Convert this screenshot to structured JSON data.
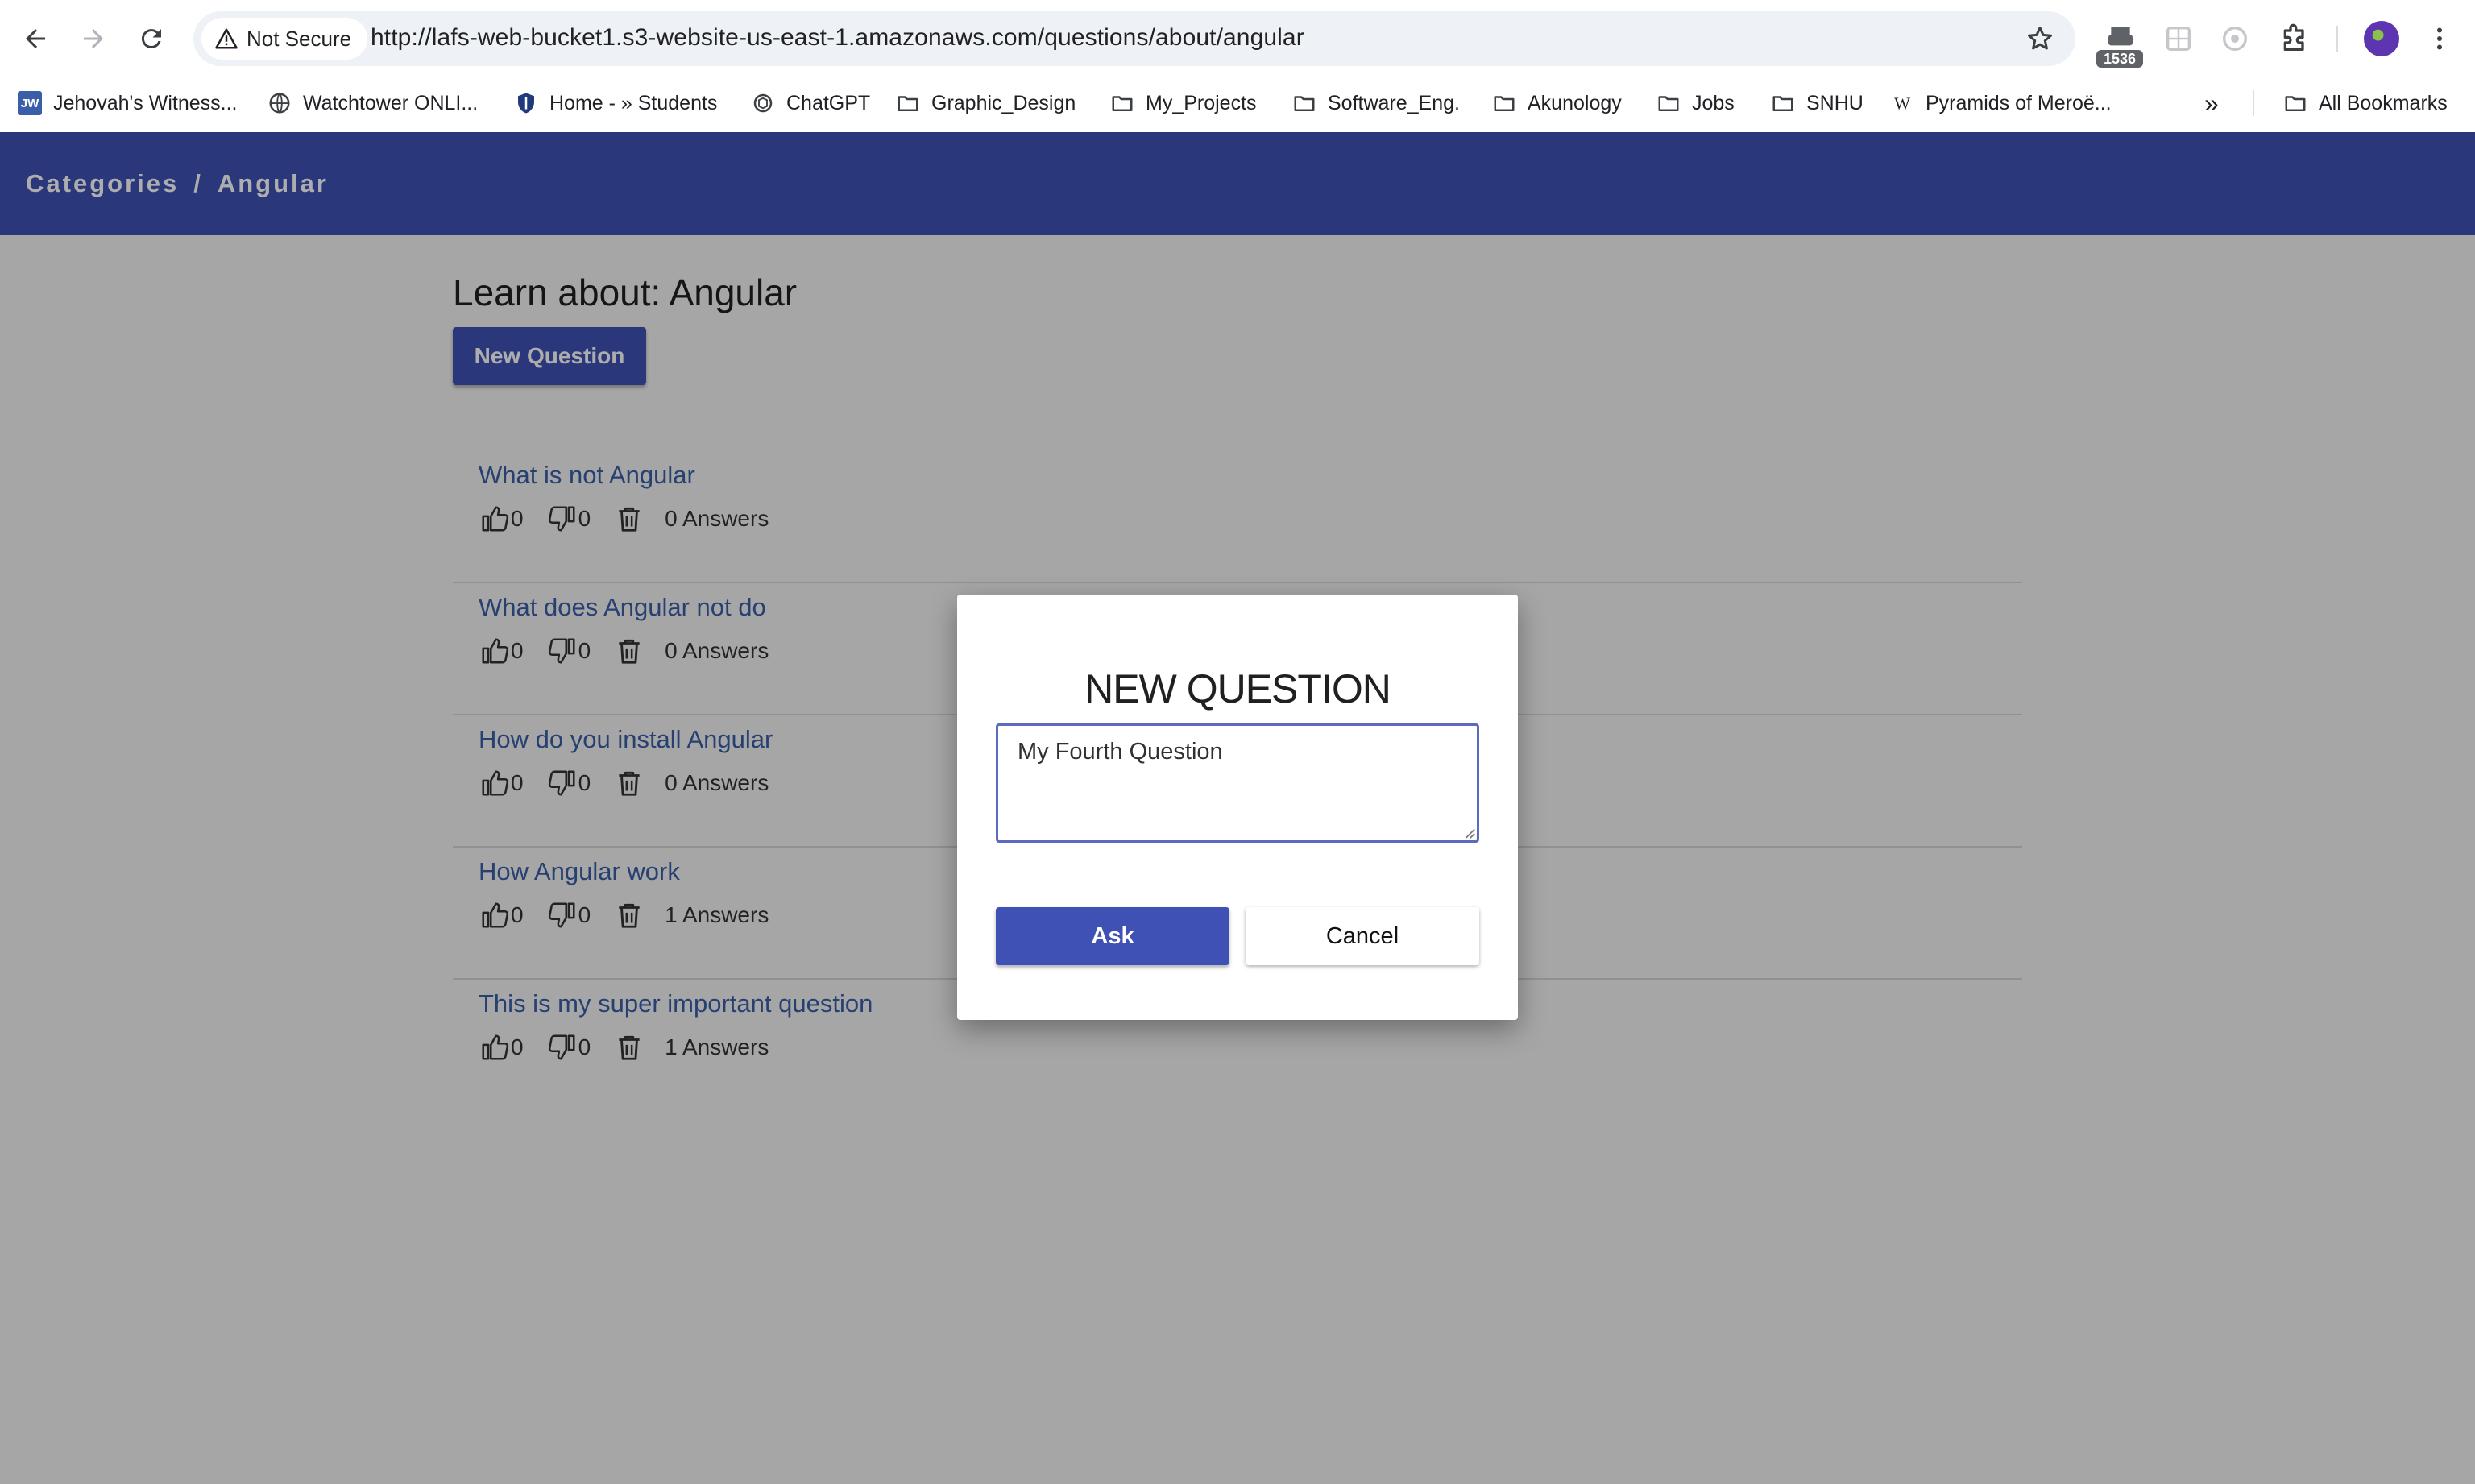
{
  "browser": {
    "security_label": "Not Secure",
    "url": "http://lafs-web-bucket1.s3-website-us-east-1.amazonaws.com/questions/about/angular",
    "extension_badge": "1536",
    "bookmarks": [
      {
        "label": "Jehovah's Witness...",
        "icon": "jw-icon"
      },
      {
        "label": "Watchtower ONLI...",
        "icon": "globe-icon"
      },
      {
        "label": "Home - » Students",
        "icon": "shield-icon"
      },
      {
        "label": "ChatGPT",
        "icon": "chatgpt-icon"
      },
      {
        "label": "Graphic_Design",
        "icon": "folder-icon"
      },
      {
        "label": "My_Projects",
        "icon": "folder-icon"
      },
      {
        "label": "Software_Eng.",
        "icon": "folder-icon"
      },
      {
        "label": "Akunology",
        "icon": "folder-icon"
      },
      {
        "label": "Jobs",
        "icon": "folder-icon"
      },
      {
        "label": "SNHU",
        "icon": "folder-icon"
      },
      {
        "label": "Pyramids of Meroë...",
        "icon": "wikipedia-icon"
      }
    ],
    "all_bookmarks_label": "All Bookmarks",
    "overflow_label": "»"
  },
  "app": {
    "breadcrumb": {
      "root": "Categories",
      "separator": "/",
      "current": "Angular"
    },
    "heading": "Learn about: Angular",
    "new_question_label": "New Question",
    "questions": [
      {
        "title": "What is not Angular",
        "up": "0",
        "down": "0",
        "answers": "0 Answers"
      },
      {
        "title": "What does Angular not do",
        "up": "0",
        "down": "0",
        "answers": "0 Answers"
      },
      {
        "title": "How do you install Angular",
        "up": "0",
        "down": "0",
        "answers": "0 Answers"
      },
      {
        "title": "How Angular work",
        "up": "0",
        "down": "0",
        "answers": "1 Answers"
      },
      {
        "title": "This is my super important question",
        "up": "0",
        "down": "0",
        "answers": "1 Answers"
      }
    ]
  },
  "dialog": {
    "title": "NEW QUESTION",
    "input_value": "My Fourth Question",
    "ask_label": "Ask",
    "cancel_label": "Cancel"
  },
  "colors": {
    "primary": "#3f51b5",
    "link": "#3a5fa8",
    "overlay": "rgba(0,0,0,0.32)"
  }
}
